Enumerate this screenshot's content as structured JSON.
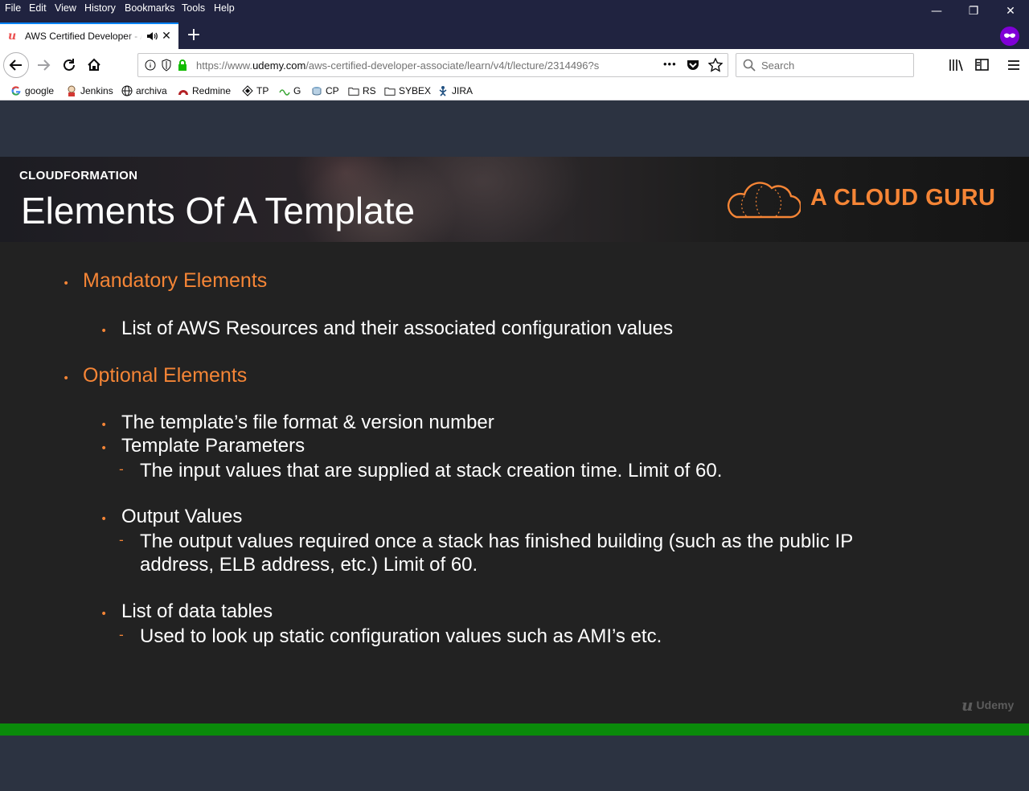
{
  "menubar": {
    "items": [
      "File",
      "Edit",
      "View",
      "History",
      "Bookmarks",
      "Tools",
      "Help"
    ]
  },
  "window_controls": {
    "minimize": "—",
    "restore": "❐",
    "close": "✕"
  },
  "tab": {
    "title": "AWS Certified Developer - A",
    "close": "✕"
  },
  "new_tab": "+",
  "navbar": {
    "url_prefix": "https://www.",
    "url_host": "udemy.com",
    "url_path": "/aws-certified-developer-associate/learn/v4/t/lecture/2314496?s",
    "more": "•••",
    "search_placeholder": "Search"
  },
  "bookmarks": [
    "google",
    "Jenkins",
    "archiva",
    "Redmine",
    "TP",
    "G",
    "CP",
    "RS",
    "SYBEX",
    "JIRA"
  ],
  "slide": {
    "eyebrow": "CLOUDFORMATION",
    "title": "Elements Of A Template",
    "logo_text": "A CLOUD GURU",
    "bullets": {
      "mandatory": "Mandatory Elements",
      "mandatory_1": "List of AWS Resources and their associated configuration values",
      "optional": "Optional Elements",
      "optional_1": "The template’s file format & version number",
      "optional_2": "Template Parameters",
      "optional_2_sub": "The input values that are supplied at stack creation time. Limit of 60.",
      "optional_3": "Output Values",
      "optional_3_sub_line1": "The output values required once a stack has finished building (such as the public IP",
      "optional_3_sub_line2": "address, ELB address, etc.) Limit of 60.",
      "optional_4": "List of data tables",
      "optional_4_sub": "Used to look up static configuration values such as AMI’s etc."
    },
    "bullet_dot": "•",
    "sub_dash": "-",
    "watermark": "Udemy",
    "watermark_glyph": "u"
  },
  "colors": {
    "accent_orange": "#f58536",
    "progress_green": "#0a8a0a",
    "chrome_dark": "#202340"
  },
  "video_progress": 1.0
}
